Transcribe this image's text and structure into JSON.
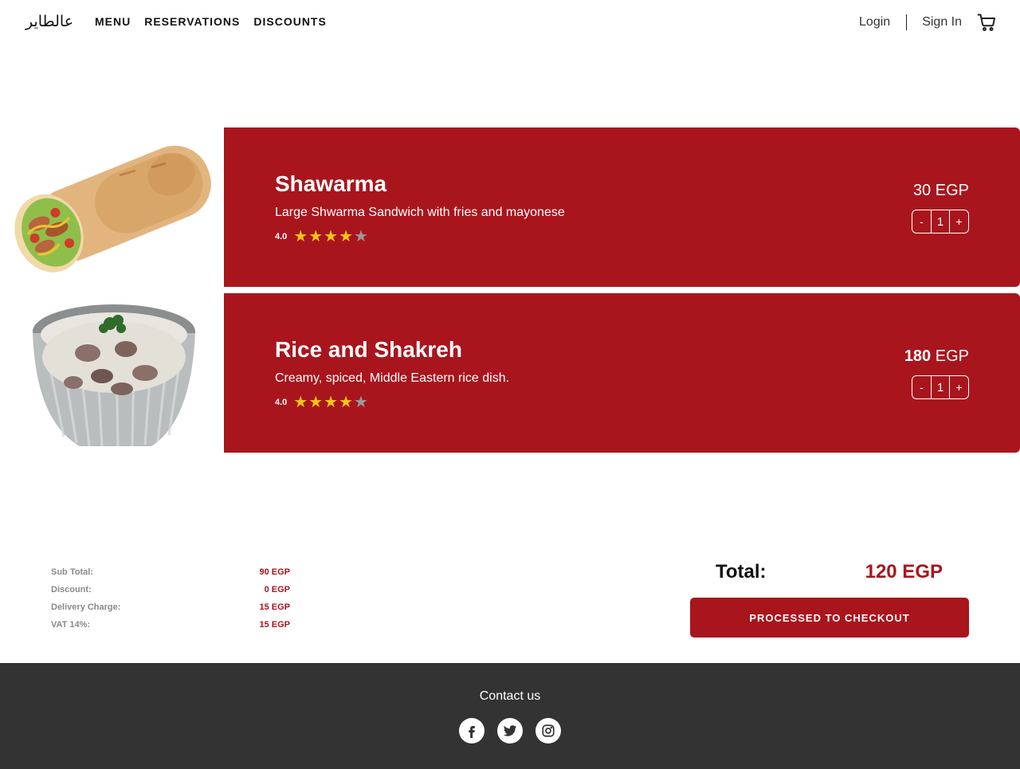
{
  "header": {
    "logo": "عالطاير",
    "nav": [
      "MENU",
      "RESERVATIONS",
      "DISCOUNTS"
    ],
    "login": "Login",
    "signin": "Sign In",
    "cart_icon": "cart-icon"
  },
  "items": [
    {
      "name": "Shawarma",
      "description": "Large Shwarma Sandwich with fries and mayonese",
      "rating": "4.0",
      "stars": 4,
      "price_number": "30",
      "price_currency": "EGP",
      "quantity": "1",
      "minus": "-",
      "plus": "+"
    },
    {
      "name": "Rice and Shakreh",
      "description": "Creamy, spiced, Middle Eastern rice dish.",
      "rating": "4.0",
      "stars": 4,
      "price_number": "180",
      "price_currency": "EGP",
      "quantity": "1",
      "minus": "-",
      "plus": "+"
    }
  ],
  "summary": {
    "rows": [
      {
        "label": "Sub Total:",
        "value": "90 EGP"
      },
      {
        "label": "Discount:",
        "value": "0 EGP"
      },
      {
        "label": "Delivery Charge:",
        "value": "15 EGP"
      },
      {
        "label": "VAT 14%:",
        "value": "15 EGP"
      }
    ],
    "total_label": "Total:",
    "total_value": "120 EGP",
    "checkout_label": "PROCESSED TO CHECKOUT"
  },
  "footer": {
    "contact": "Contact us",
    "socials": [
      "facebook-icon",
      "twitter-icon",
      "instagram-icon"
    ]
  },
  "colors": {
    "accent": "#a9151d",
    "footer_bg": "#333333",
    "star_on": "#f5c518",
    "star_off": "#9a9a9a"
  }
}
